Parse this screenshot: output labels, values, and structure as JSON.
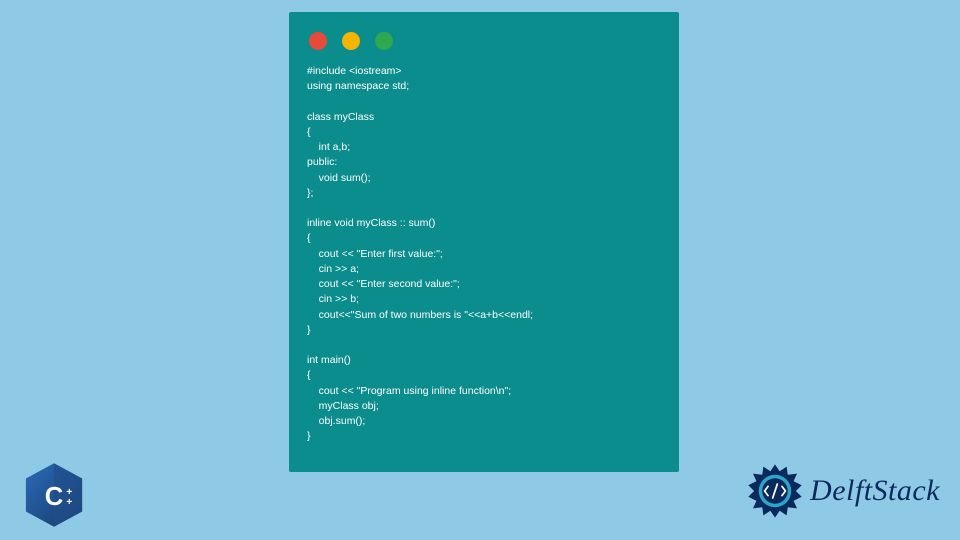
{
  "code": {
    "lines": [
      "#include <iostream>",
      "using namespace std;",
      "",
      "class myClass",
      "{",
      "    int a,b;",
      "public:",
      "    void sum();",
      "};",
      "",
      "inline void myClass :: sum()",
      "{",
      "    cout << \"Enter first value:\";",
      "    cin >> a;",
      "    cout << \"Enter second value:\";",
      "    cin >> b;",
      "    cout<<\"Sum of two numbers is \"<<a+b<<endl;",
      "}",
      "",
      "int main()",
      "{",
      "    cout << \"Program using inline function\\n\";",
      "    myClass obj;",
      "    obj.sum();",
      "}"
    ]
  },
  "badges": {
    "cpp_label": "C++"
  },
  "brand": {
    "name": "DelftStack"
  },
  "colors": {
    "bg": "#8ecae6",
    "card": "#0b8d8d",
    "logo_blue": "#0a2a5e",
    "logo_accent": "#2aa6c9",
    "cpp_blue": "#1f4e8c",
    "cpp_blue_dark": "#173a68"
  }
}
